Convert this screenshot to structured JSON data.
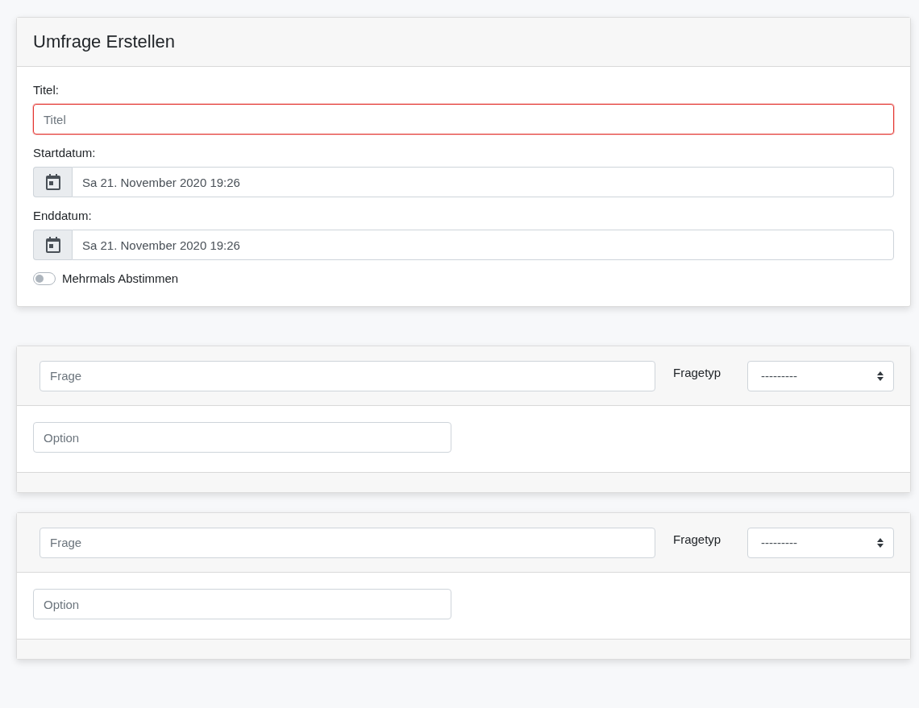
{
  "poll_card": {
    "title": "Umfrage Erstellen",
    "title_field": {
      "label": "Titel:",
      "placeholder": "Titel",
      "invalid": true
    },
    "date_fields": [
      {
        "label": "Startdatum:",
        "value": "Sa 21. November 2020 19:26"
      },
      {
        "label": "Enddatum:",
        "value": "Sa 21. November 2020 19:26"
      }
    ],
    "multiple_votes": {
      "label": "Mehrmals Abstimmen",
      "on": false
    }
  },
  "questions": [
    {
      "question_placeholder": "Frage",
      "type_label": "Fragetyp",
      "type_value": "---------",
      "option_placeholder": "Option"
    },
    {
      "question_placeholder": "Frage",
      "type_label": "Fragetyp",
      "type_value": "---------",
      "option_placeholder": "Option"
    }
  ]
}
